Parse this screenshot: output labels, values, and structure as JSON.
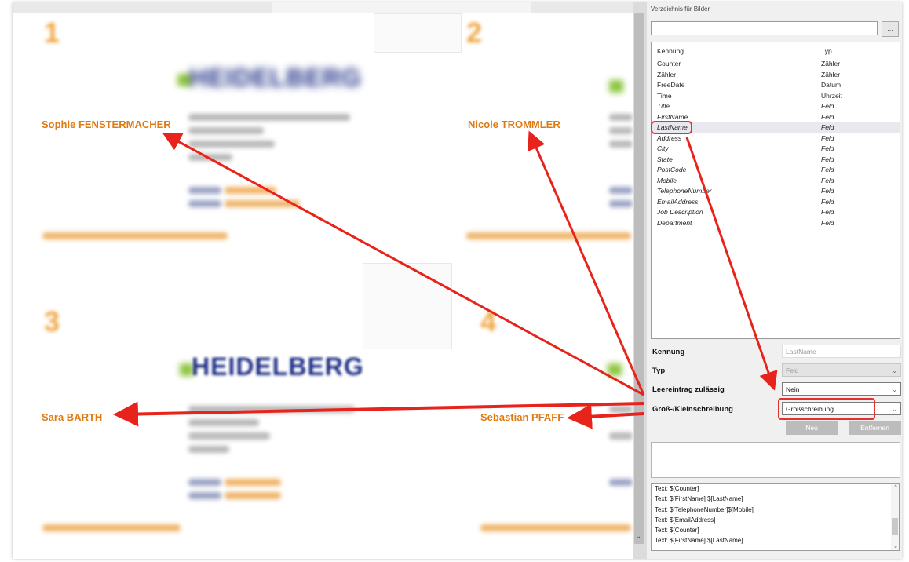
{
  "cards": {
    "numbers": [
      "1",
      "2",
      "3",
      "4"
    ],
    "logo_text": "HEIDELBERG",
    "names": {
      "top_left": "Sophie FENSTERMACHER",
      "top_right": "Nicole TROMMLER",
      "bottom_left": "Sara BARTH",
      "bottom_right": "Sebastian PFAFF"
    }
  },
  "panel": {
    "section_caption": "Verzeichnis für Bilder",
    "browse_label": "...",
    "list_headers": {
      "id": "Kennung",
      "type": "Typ"
    },
    "fields": [
      {
        "name": "Counter",
        "type": "Zähler"
      },
      {
        "name": "Zähler",
        "type": "Zähler"
      },
      {
        "name": "FreeDate",
        "type": "Datum"
      },
      {
        "name": "Time",
        "type": "Uhrzeit"
      },
      {
        "name": "Title",
        "type": "Feld"
      },
      {
        "name": "FirstName",
        "type": "Feld"
      },
      {
        "name": "LastName",
        "type": "Feld"
      },
      {
        "name": "Address",
        "type": "Feld"
      },
      {
        "name": "City",
        "type": "Feld"
      },
      {
        "name": "State",
        "type": "Feld"
      },
      {
        "name": "PostCode",
        "type": "Feld"
      },
      {
        "name": "Mobile",
        "type": "Feld"
      },
      {
        "name": "TelephoneNumber",
        "type": "Feld"
      },
      {
        "name": "EmailAddress",
        "type": "Feld"
      },
      {
        "name": "Job Description",
        "type": "Feld"
      },
      {
        "name": "Department",
        "type": "Feld"
      }
    ],
    "selected_field": "LastName",
    "form": {
      "id_label": "Kennung",
      "id_value": "LastName",
      "type_label": "Typ",
      "type_value": "Feld",
      "empty_label": "Leereintrag zulässig",
      "empty_value": "Nein",
      "case_label": "Groß-/Kleinschreibung",
      "case_value": "Großschreibung",
      "new_button": "Neu",
      "remove_button": "Entfernen"
    },
    "text_entries": [
      "Text: $[Counter]",
      "Text: $[FirstName] $[LastName]",
      "Text: $[TelephoneNumber]$[Mobile]",
      "Text: $[EmailAddress]",
      "Text: $[Counter]",
      "Text: $[FirstName] $[LastName]"
    ]
  },
  "colors": {
    "accent_red": "#e8231b",
    "name_orange": "#e07a12",
    "card_number_orange": "#f0a540",
    "logo_blue": "#1f2f87"
  }
}
